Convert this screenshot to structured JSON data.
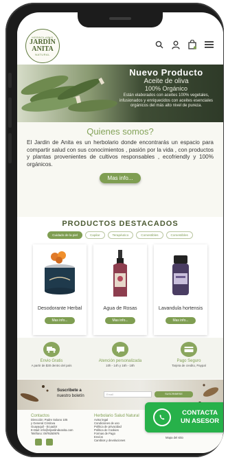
{
  "logo": {
    "top": "HERBOLARIO",
    "line1": "JARDÍN",
    "line2": "ANITA",
    "bottom": "NATURAL"
  },
  "header": {
    "icons": [
      "search-icon",
      "user-icon",
      "bag-icon",
      "menu-icon"
    ],
    "cart_count": "0"
  },
  "hero": {
    "title": "Nuevo Producto",
    "subtitle": "Aceite de oliva",
    "subtitle2": "100% Orgánico",
    "description": "Están elaborados con aceites 100% vegetales, infusionados y enriquecidos con aceites esenciales orgánicos del más alto nivel de pureza."
  },
  "about": {
    "title": "Quienes somos?",
    "body": "El Jardin de Anita es un herbolario donde encontrarás un espacio para compartir salud con sus conocimientos , pasión por la vida , con productos y plantas provenientes de cultivos responsables , ecofriendly y 100% orgánicos.",
    "button": "Mas info..."
  },
  "products": {
    "title": "PRODUCTOS DESTACADOS",
    "categories": [
      "Cuidado de la piel",
      "Capilar",
      "Terapéutico",
      "Comestibles",
      "Comestibles"
    ],
    "items": [
      {
        "name": "Desodorante Herbal",
        "button": "Mas info..."
      },
      {
        "name": "Agua de Rosas",
        "button": "Mas info..."
      },
      {
        "name": "Lavandula hortensis",
        "button": "Mas info..."
      }
    ]
  },
  "services": [
    {
      "title": "Envio Gratis",
      "sub": "A partir de $30 dentro del país",
      "icon": "truck-icon"
    },
    {
      "title": "Atención personalizada",
      "sub": "10h - 14h y 16h - 18h",
      "icon": "chat-icon"
    },
    {
      "title": "Pago Seguro",
      "sub": "Tarjeta de credito, Paypal",
      "icon": "card-icon"
    }
  ],
  "newsletter": {
    "label1": "Suscribete a",
    "label2": "nuestro boletín",
    "placeholder": "Email",
    "button": "SUSCRIBIRSE"
  },
  "footer": {
    "contact_title": "Contactos",
    "contact_lines": [
      "Dirección: Padre Solano 105",
      "y General Córdova",
      "Guayaquil - Ecuador",
      "E-Mail: info@eljardindeanita.com",
      "Teléfono: 0979250976"
    ],
    "info_title": "Herbolario Salud Natural",
    "info_lines": [
      "Aviso legal",
      "Condiciones de uso",
      "Política de privacidad",
      "Política de Cookies",
      "Formas de Pago",
      "Envíos",
      "Cambios y devoluciones"
    ],
    "map_label": "Mapa del sitio"
  },
  "whatsapp": {
    "line1": "CONTACTA",
    "line2": "UN ASESOR"
  },
  "colors": {
    "accent": "#7f9e52",
    "title_dark": "#4b5a32",
    "whatsapp": "#27b14a"
  }
}
